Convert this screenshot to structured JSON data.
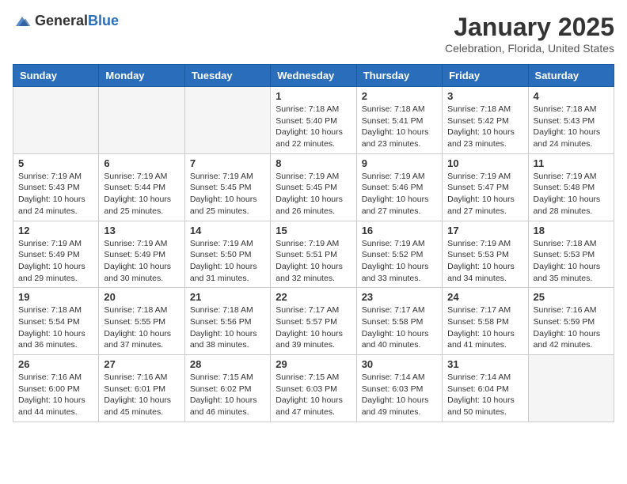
{
  "logo": {
    "general": "General",
    "blue": "Blue"
  },
  "header": {
    "month": "January 2025",
    "location": "Celebration, Florida, United States"
  },
  "weekdays": [
    "Sunday",
    "Monday",
    "Tuesday",
    "Wednesday",
    "Thursday",
    "Friday",
    "Saturday"
  ],
  "weeks": [
    [
      {
        "day": "",
        "sunrise": "",
        "sunset": "",
        "daylight": ""
      },
      {
        "day": "",
        "sunrise": "",
        "sunset": "",
        "daylight": ""
      },
      {
        "day": "",
        "sunrise": "",
        "sunset": "",
        "daylight": ""
      },
      {
        "day": "1",
        "sunrise": "Sunrise: 7:18 AM",
        "sunset": "Sunset: 5:40 PM",
        "daylight": "Daylight: 10 hours and 22 minutes."
      },
      {
        "day": "2",
        "sunrise": "Sunrise: 7:18 AM",
        "sunset": "Sunset: 5:41 PM",
        "daylight": "Daylight: 10 hours and 23 minutes."
      },
      {
        "day": "3",
        "sunrise": "Sunrise: 7:18 AM",
        "sunset": "Sunset: 5:42 PM",
        "daylight": "Daylight: 10 hours and 23 minutes."
      },
      {
        "day": "4",
        "sunrise": "Sunrise: 7:18 AM",
        "sunset": "Sunset: 5:43 PM",
        "daylight": "Daylight: 10 hours and 24 minutes."
      }
    ],
    [
      {
        "day": "5",
        "sunrise": "Sunrise: 7:19 AM",
        "sunset": "Sunset: 5:43 PM",
        "daylight": "Daylight: 10 hours and 24 minutes."
      },
      {
        "day": "6",
        "sunrise": "Sunrise: 7:19 AM",
        "sunset": "Sunset: 5:44 PM",
        "daylight": "Daylight: 10 hours and 25 minutes."
      },
      {
        "day": "7",
        "sunrise": "Sunrise: 7:19 AM",
        "sunset": "Sunset: 5:45 PM",
        "daylight": "Daylight: 10 hours and 25 minutes."
      },
      {
        "day": "8",
        "sunrise": "Sunrise: 7:19 AM",
        "sunset": "Sunset: 5:45 PM",
        "daylight": "Daylight: 10 hours and 26 minutes."
      },
      {
        "day": "9",
        "sunrise": "Sunrise: 7:19 AM",
        "sunset": "Sunset: 5:46 PM",
        "daylight": "Daylight: 10 hours and 27 minutes."
      },
      {
        "day": "10",
        "sunrise": "Sunrise: 7:19 AM",
        "sunset": "Sunset: 5:47 PM",
        "daylight": "Daylight: 10 hours and 27 minutes."
      },
      {
        "day": "11",
        "sunrise": "Sunrise: 7:19 AM",
        "sunset": "Sunset: 5:48 PM",
        "daylight": "Daylight: 10 hours and 28 minutes."
      }
    ],
    [
      {
        "day": "12",
        "sunrise": "Sunrise: 7:19 AM",
        "sunset": "Sunset: 5:49 PM",
        "daylight": "Daylight: 10 hours and 29 minutes."
      },
      {
        "day": "13",
        "sunrise": "Sunrise: 7:19 AM",
        "sunset": "Sunset: 5:49 PM",
        "daylight": "Daylight: 10 hours and 30 minutes."
      },
      {
        "day": "14",
        "sunrise": "Sunrise: 7:19 AM",
        "sunset": "Sunset: 5:50 PM",
        "daylight": "Daylight: 10 hours and 31 minutes."
      },
      {
        "day": "15",
        "sunrise": "Sunrise: 7:19 AM",
        "sunset": "Sunset: 5:51 PM",
        "daylight": "Daylight: 10 hours and 32 minutes."
      },
      {
        "day": "16",
        "sunrise": "Sunrise: 7:19 AM",
        "sunset": "Sunset: 5:52 PM",
        "daylight": "Daylight: 10 hours and 33 minutes."
      },
      {
        "day": "17",
        "sunrise": "Sunrise: 7:19 AM",
        "sunset": "Sunset: 5:53 PM",
        "daylight": "Daylight: 10 hours and 34 minutes."
      },
      {
        "day": "18",
        "sunrise": "Sunrise: 7:18 AM",
        "sunset": "Sunset: 5:53 PM",
        "daylight": "Daylight: 10 hours and 35 minutes."
      }
    ],
    [
      {
        "day": "19",
        "sunrise": "Sunrise: 7:18 AM",
        "sunset": "Sunset: 5:54 PM",
        "daylight": "Daylight: 10 hours and 36 minutes."
      },
      {
        "day": "20",
        "sunrise": "Sunrise: 7:18 AM",
        "sunset": "Sunset: 5:55 PM",
        "daylight": "Daylight: 10 hours and 37 minutes."
      },
      {
        "day": "21",
        "sunrise": "Sunrise: 7:18 AM",
        "sunset": "Sunset: 5:56 PM",
        "daylight": "Daylight: 10 hours and 38 minutes."
      },
      {
        "day": "22",
        "sunrise": "Sunrise: 7:17 AM",
        "sunset": "Sunset: 5:57 PM",
        "daylight": "Daylight: 10 hours and 39 minutes."
      },
      {
        "day": "23",
        "sunrise": "Sunrise: 7:17 AM",
        "sunset": "Sunset: 5:58 PM",
        "daylight": "Daylight: 10 hours and 40 minutes."
      },
      {
        "day": "24",
        "sunrise": "Sunrise: 7:17 AM",
        "sunset": "Sunset: 5:58 PM",
        "daylight": "Daylight: 10 hours and 41 minutes."
      },
      {
        "day": "25",
        "sunrise": "Sunrise: 7:16 AM",
        "sunset": "Sunset: 5:59 PM",
        "daylight": "Daylight: 10 hours and 42 minutes."
      }
    ],
    [
      {
        "day": "26",
        "sunrise": "Sunrise: 7:16 AM",
        "sunset": "Sunset: 6:00 PM",
        "daylight": "Daylight: 10 hours and 44 minutes."
      },
      {
        "day": "27",
        "sunrise": "Sunrise: 7:16 AM",
        "sunset": "Sunset: 6:01 PM",
        "daylight": "Daylight: 10 hours and 45 minutes."
      },
      {
        "day": "28",
        "sunrise": "Sunrise: 7:15 AM",
        "sunset": "Sunset: 6:02 PM",
        "daylight": "Daylight: 10 hours and 46 minutes."
      },
      {
        "day": "29",
        "sunrise": "Sunrise: 7:15 AM",
        "sunset": "Sunset: 6:03 PM",
        "daylight": "Daylight: 10 hours and 47 minutes."
      },
      {
        "day": "30",
        "sunrise": "Sunrise: 7:14 AM",
        "sunset": "Sunset: 6:03 PM",
        "daylight": "Daylight: 10 hours and 49 minutes."
      },
      {
        "day": "31",
        "sunrise": "Sunrise: 7:14 AM",
        "sunset": "Sunset: 6:04 PM",
        "daylight": "Daylight: 10 hours and 50 minutes."
      },
      {
        "day": "",
        "sunrise": "",
        "sunset": "",
        "daylight": ""
      }
    ]
  ]
}
